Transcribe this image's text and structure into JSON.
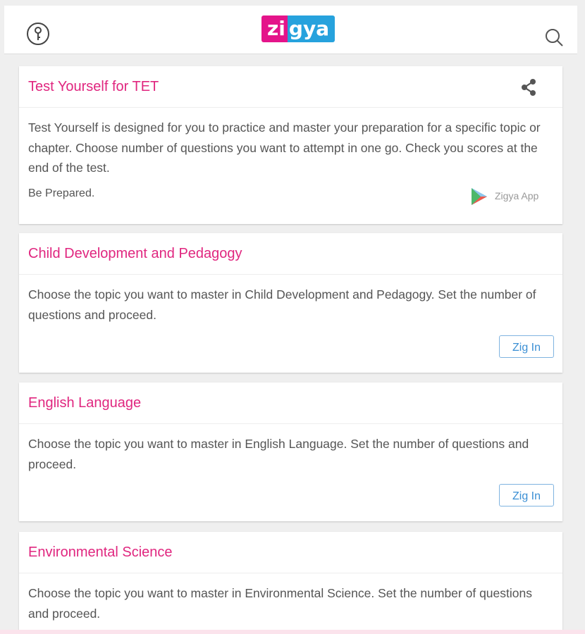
{
  "header": {
    "logo_part1": "zi",
    "logo_part2": "gya"
  },
  "intro_card": {
    "title": "Test Yourself for TET",
    "body": "Test Yourself is designed for you to practice and master your preparation for a specific topic or chapter. Choose number of questions you want to attempt in one go. Check you scores at the end of the test.",
    "tagline": "Be Prepared.",
    "app_label": "Zigya App"
  },
  "topics": [
    {
      "title": "Child Development and Pedagogy",
      "body": "Choose the topic you want to master in Child Development and Pedagogy. Set the number of questions and proceed.",
      "button": "Zig In"
    },
    {
      "title": "English Language",
      "body": "Choose the topic you want to master in English Language. Set the number of questions and proceed.",
      "button": "Zig In"
    },
    {
      "title": "Environmental Science",
      "body": "Choose the topic you want to master in Environmental Science. Set the number of questions and proceed."
    }
  ],
  "icons": {
    "top_left": "key-icon",
    "top_right": "search-icon",
    "card_action": "share-icon",
    "app_store": "play-store-icon"
  },
  "colors": {
    "title": "#e0267f",
    "logo_pink": "#e4148a",
    "logo_blue": "#26a2dd",
    "button": "#3b8fd4"
  }
}
